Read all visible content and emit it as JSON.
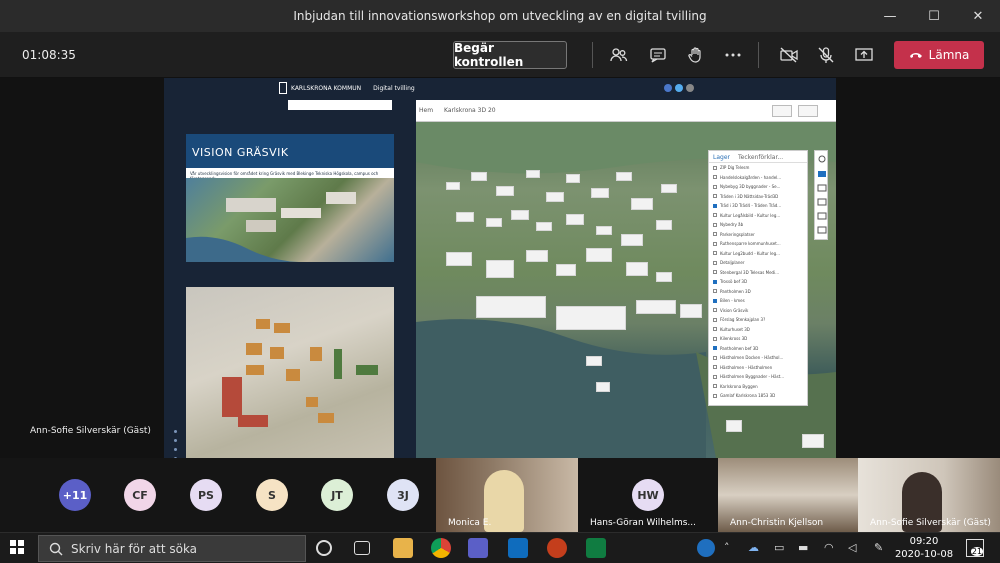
{
  "window": {
    "title": "Inbjudan till innovationsworkshop om utveckling av en digital tvilling",
    "minimize": "—",
    "maximize": "☐",
    "close": "✕"
  },
  "toolbar": {
    "timer": "01:08:35",
    "request_control": "Begär kontrollen",
    "leave": "Lämna"
  },
  "share": {
    "logo_text": "KARLSKRONA KOMMUN",
    "logo_sub": "Digital tvilling",
    "card_title": "VISION GRÄSVIK",
    "card_sub": "Vår utvecklingsvision för området kring Gräsvik med Blekinge Tekniska Högskola, campus och företagspark",
    "map_nav": "Hem",
    "map_title": "Karlskrona 3D 20",
    "layer_tab_layers": "Lager",
    "layer_tab_legend": "Teckenförklar...",
    "layers": [
      {
        "label": "ZIP Dig Telesm",
        "on": false
      },
      {
        "label": "Handelslokalgården - handel...",
        "on": false
      },
      {
        "label": "Nybebyg 3D byggnader - Se...",
        "on": false
      },
      {
        "label": "Träden i 3D Nättsidav-Träd3D",
        "on": false
      },
      {
        "label": "Träd i 3D Träd4 - Träden Träd...",
        "on": true
      },
      {
        "label": "Kultur Legålsbild - Kultur leg...",
        "on": false
      },
      {
        "label": "Nybedry åb",
        "on": false
      },
      {
        "label": "Parkeringsplatser",
        "on": false
      },
      {
        "label": "Ruthensparre kommunhuset...",
        "on": false
      },
      {
        "label": "Kultur Leg2budd - Kultur leg...",
        "on": false
      },
      {
        "label": "Detaljplaner",
        "on": false
      },
      {
        "label": "Stenbergal 3D Telesas Medi...",
        "on": false
      },
      {
        "label": "Trossö bef 3D",
        "on": true
      },
      {
        "label": "Pantholmen 3D",
        "on": false
      },
      {
        "label": "Bilen - kmes",
        "on": true
      },
      {
        "label": "Vision Gräsvik",
        "on": false
      },
      {
        "label": "Förslag Stenkajplan 3?",
        "on": false
      },
      {
        "label": "Kulturhuset 3D",
        "on": false
      },
      {
        "label": "Kilenkross 3D",
        "on": false
      },
      {
        "label": "Pantholmen bef 3D",
        "on": true
      },
      {
        "label": "Hästholmen Docken - Hästhol...",
        "on": false
      },
      {
        "label": "Hästholmen - Hästholmen",
        "on": false
      },
      {
        "label": "Hästholmen Byggnader - Häst...",
        "on": false
      },
      {
        "label": "Karlskrona Byggen",
        "on": false
      },
      {
        "label": "Gamlaf Karlskrona 1853 3D",
        "on": false
      }
    ]
  },
  "stage": {
    "speaker_name": "Ann-Sofie Silverskär (Gäst)"
  },
  "participants": {
    "overflow": "+11",
    "avatars": [
      {
        "initials": "CF",
        "color": "#f1d6e8"
      },
      {
        "initials": "PS",
        "color": "#e6dcf3"
      },
      {
        "initials": "S",
        "color": "#f6e3c4"
      },
      {
        "initials": "JT",
        "color": "#dcefd6"
      },
      {
        "initials": "3J",
        "color": "#dfe3f5"
      }
    ],
    "tiles": [
      {
        "name": "Monica E."
      },
      {
        "initials": "HW",
        "name": "Hans-Göran Wilhelms..."
      },
      {
        "name": "Ann-Christin Kjellson"
      },
      {
        "name": "Ann-Sofie Silverskär (Gäst)"
      }
    ]
  },
  "taskbar": {
    "search_placeholder": "Skriv här för att söka",
    "time": "09:20",
    "date": "2020-10-08",
    "notifications": "21"
  }
}
